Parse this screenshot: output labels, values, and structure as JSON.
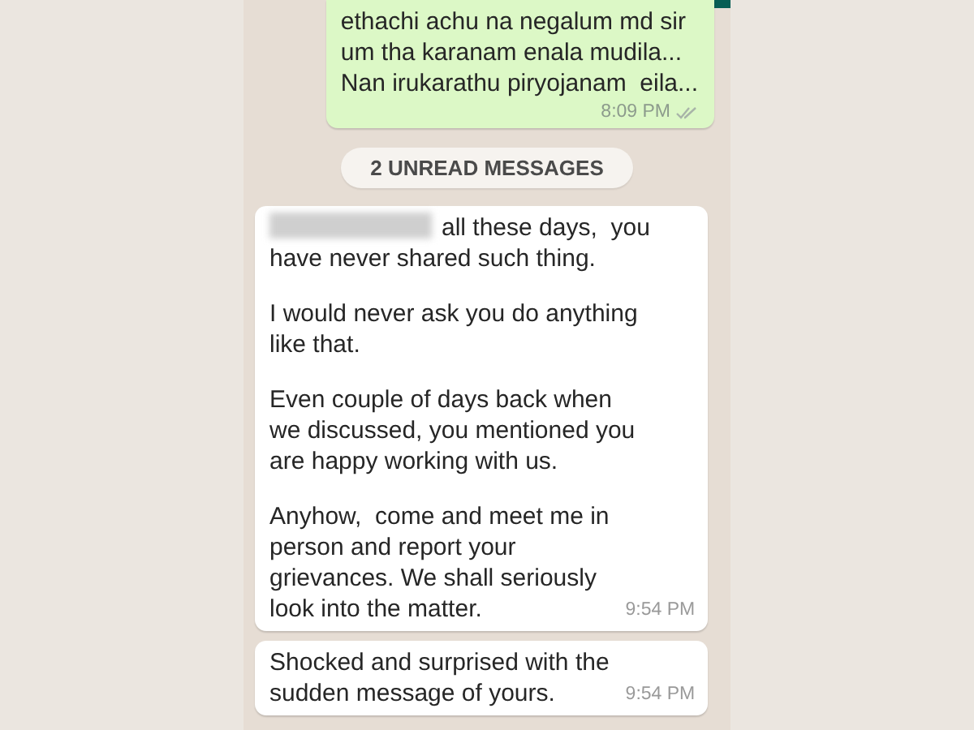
{
  "messages": [
    {
      "kind": "outgoing",
      "paragraphs": [
        "ethachi achu na negalum md sir\num tha karanam enala mudila...\nNan irukarathu piryojanam  eila..."
      ],
      "time": "8:09 PM"
    },
    {
      "kind": "divider",
      "label": "2 UNREAD MESSAGES"
    },
    {
      "kind": "incoming",
      "redacted": true,
      "paragraphs": [
        "all these days,  you\nhave never shared such thing.",
        "I would never ask you do anything\nlike that.",
        "Even couple of days back when\nwe discussed, you mentioned you\nare happy working with us.",
        "Anyhow,  come and meet me in\nperson and report your\ngrievances. We shall seriously\nlook into the matter."
      ],
      "time": "9:54 PM"
    },
    {
      "kind": "incoming",
      "redacted": false,
      "paragraphs": [
        "Shocked and surprised with the\nsudden message of yours."
      ],
      "time": "9:54 PM"
    }
  ]
}
